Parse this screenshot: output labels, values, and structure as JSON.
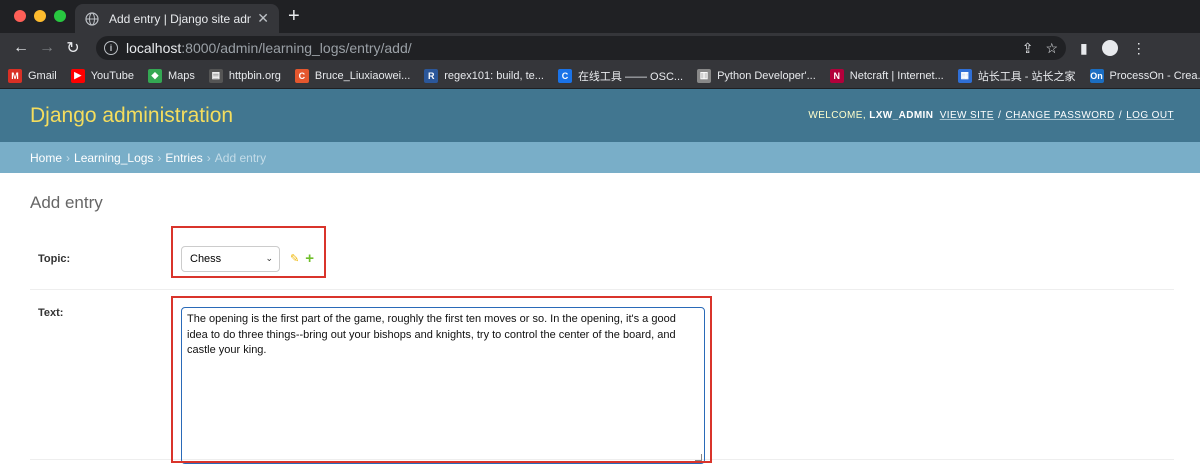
{
  "browser": {
    "tab_title": "Add entry | Django site admin",
    "tab_close": "✕",
    "new_tab": "+",
    "url_host": "localhost",
    "url_rest": ":8000/admin/learning_logs/entry/add/",
    "bookmarks": [
      {
        "label": "Gmail",
        "icon": "M",
        "color": "#d93025"
      },
      {
        "label": "YouTube",
        "icon": "▶",
        "color": "#ff0000"
      },
      {
        "label": "Maps",
        "icon": "◆",
        "color": "#34a853"
      },
      {
        "label": "httpbin.org",
        "icon": "▤",
        "color": "#555"
      },
      {
        "label": "Bruce_Liuxiaowei...",
        "icon": "C",
        "color": "#e4572e"
      },
      {
        "label": "regex101: build, te...",
        "icon": "R",
        "color": "#2b579a"
      },
      {
        "label": "在线工具 —— OSC...",
        "icon": "C",
        "color": "#1a73e8"
      },
      {
        "label": "Python Developer'...",
        "icon": "▥",
        "color": "#888"
      },
      {
        "label": "Netcraft | Internet...",
        "icon": "N",
        "color": "#b3003b"
      },
      {
        "label": "站长工具 - 站长之家",
        "icon": "▦",
        "color": "#2f6fd6"
      },
      {
        "label": "ProcessOn - Crea...",
        "icon": "On",
        "color": "#1b6ec2"
      }
    ],
    "bookmarks_more": "»"
  },
  "header": {
    "brand": "Django administration",
    "welcome": "Welcome,",
    "username": "lxw_admin",
    "view_site": "View site",
    "change_password": "Change password",
    "log_out": "Log out",
    "sep": "/"
  },
  "breadcrumbs": {
    "home": "Home",
    "app": "Learning_Logs",
    "model": "Entries",
    "current": "Add entry",
    "sep": "›"
  },
  "content": {
    "title": "Add entry",
    "topic_label": "Topic:",
    "topic_value": "Chess",
    "text_label": "Text:",
    "text_value": "The opening is the first part of the game, roughly the first ten moves or  so. In the opening, it's a good idea to do three things--bring out your bishops and knights, try to control the center of the board, and castle your king."
  },
  "colors": {
    "header_bg": "#417690",
    "brand": "#f5dd5d",
    "breadcrumb_bg": "#79aec8",
    "highlight": "#d9342b"
  }
}
